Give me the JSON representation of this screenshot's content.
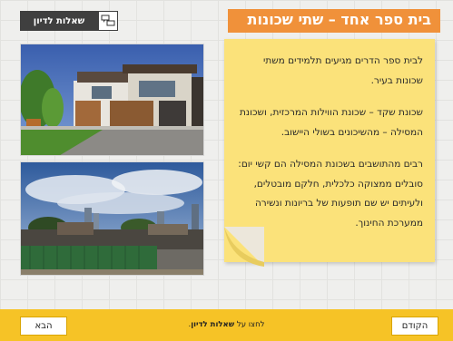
{
  "header": {
    "title": "בית ספר אחד –  שתי שכונות",
    "discussion_button_label": "שאלות לדיון",
    "discussion_icon": "discussion-icon"
  },
  "images": [
    {
      "name": "modern-house-photo",
      "alt": "modern house"
    },
    {
      "name": "neighborhood-photo",
      "alt": "neighborhood houses"
    }
  ],
  "note": {
    "paragraphs": [
      "לבית ספר הדרים מגיעים תלמידים משתי שכונות בעיר.",
      "שכונת שקד –  שכונת הווילות המרכזית, ושכונת המסילה –  מהשיכונים בשולי היישוב.",
      "רבים מהתושבים בשכונת המסילה הם קשי יום: סובלים ממצוקה כלכלית, חלקם מובטלים, ולעיתים יש שם תופעות של בריונות ונשירה ממערכת החינוך."
    ]
  },
  "footer": {
    "prev_label": "הבא",
    "next_label": "הקודם",
    "hint_prefix": "לחצו על",
    "hint_bold": "שאלות לדיון",
    "hint_suffix": "."
  },
  "colors": {
    "title_bg": "#f0913a",
    "note_bg": "#fbe27a",
    "footer_bg": "#f6c326",
    "button_dark": "#3f3f3f"
  }
}
